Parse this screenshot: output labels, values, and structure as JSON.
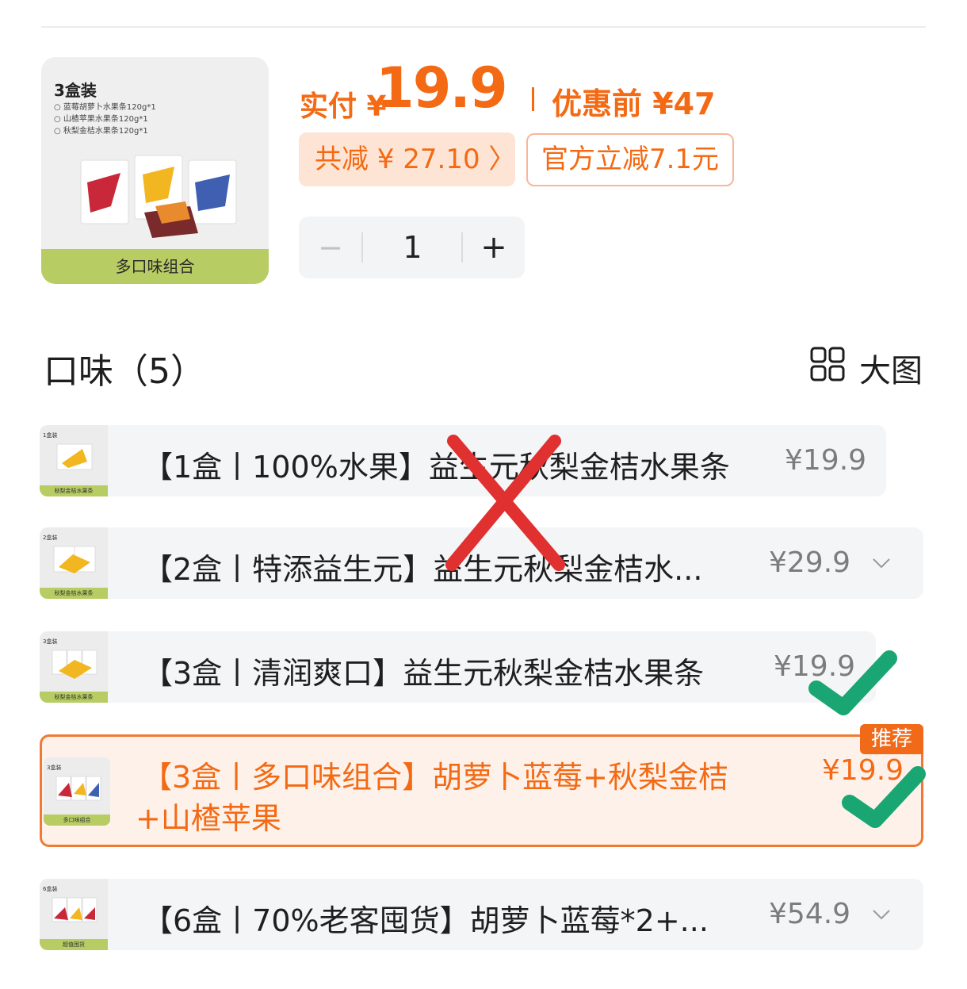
{
  "product": {
    "thumb_title": "3盒装",
    "thumb_lines": [
      "蓝莓胡萝卜水果条120g*1",
      "山楂苹果水果条120g*1",
      "秋梨金桔水果条120g*1"
    ],
    "thumb_footer": "多口味组合"
  },
  "price": {
    "pay_label": "实付 ¥",
    "pay_value": "19.9",
    "original": "优惠前 ¥47",
    "discount_pill": "共减 ¥ 27.10 〉",
    "official_pill": "官方立减7.1元"
  },
  "quantity": {
    "minus": "−",
    "value": "1",
    "plus": "+"
  },
  "section": {
    "title": "口味（5）",
    "big_view": "大图"
  },
  "options": [
    {
      "label": "【1盒丨100%水果】益生元秋梨金桔水果条",
      "price": "¥19.9",
      "thumb_tag": "1盒装",
      "thumb_foot": "秋梨金桔水果条"
    },
    {
      "label": "【2盒丨特添益生元】益生元秋梨金桔水...",
      "price": "¥29.9",
      "thumb_tag": "2盒装",
      "thumb_foot": "秋梨金桔水果条"
    },
    {
      "label": "【3盒丨清润爽口】益生元秋梨金桔水果条",
      "price": "¥19.9",
      "thumb_tag": "3盒装",
      "thumb_foot": "秋梨金桔水果条"
    },
    {
      "label_line1": "【3盒丨多口味组合】胡萝卜蓝莓+秋梨金桔",
      "label_line2": "+山楂苹果",
      "price": "¥19.9",
      "badge": "推荐",
      "thumb_tag": "3盒装",
      "thumb_foot": "多口味组合"
    },
    {
      "label": "【6盒丨70%老客囤货】胡萝卜蓝莓*2+...",
      "price": "¥54.9",
      "thumb_tag": "6盒装",
      "thumb_foot": "超值囤货"
    }
  ],
  "colors": {
    "accent": "#f46a14",
    "selected_border": "#f07a33",
    "cross_mark": "#e03030",
    "check_mark": "#1aa673",
    "thumb_footer": "#b7cc63"
  }
}
